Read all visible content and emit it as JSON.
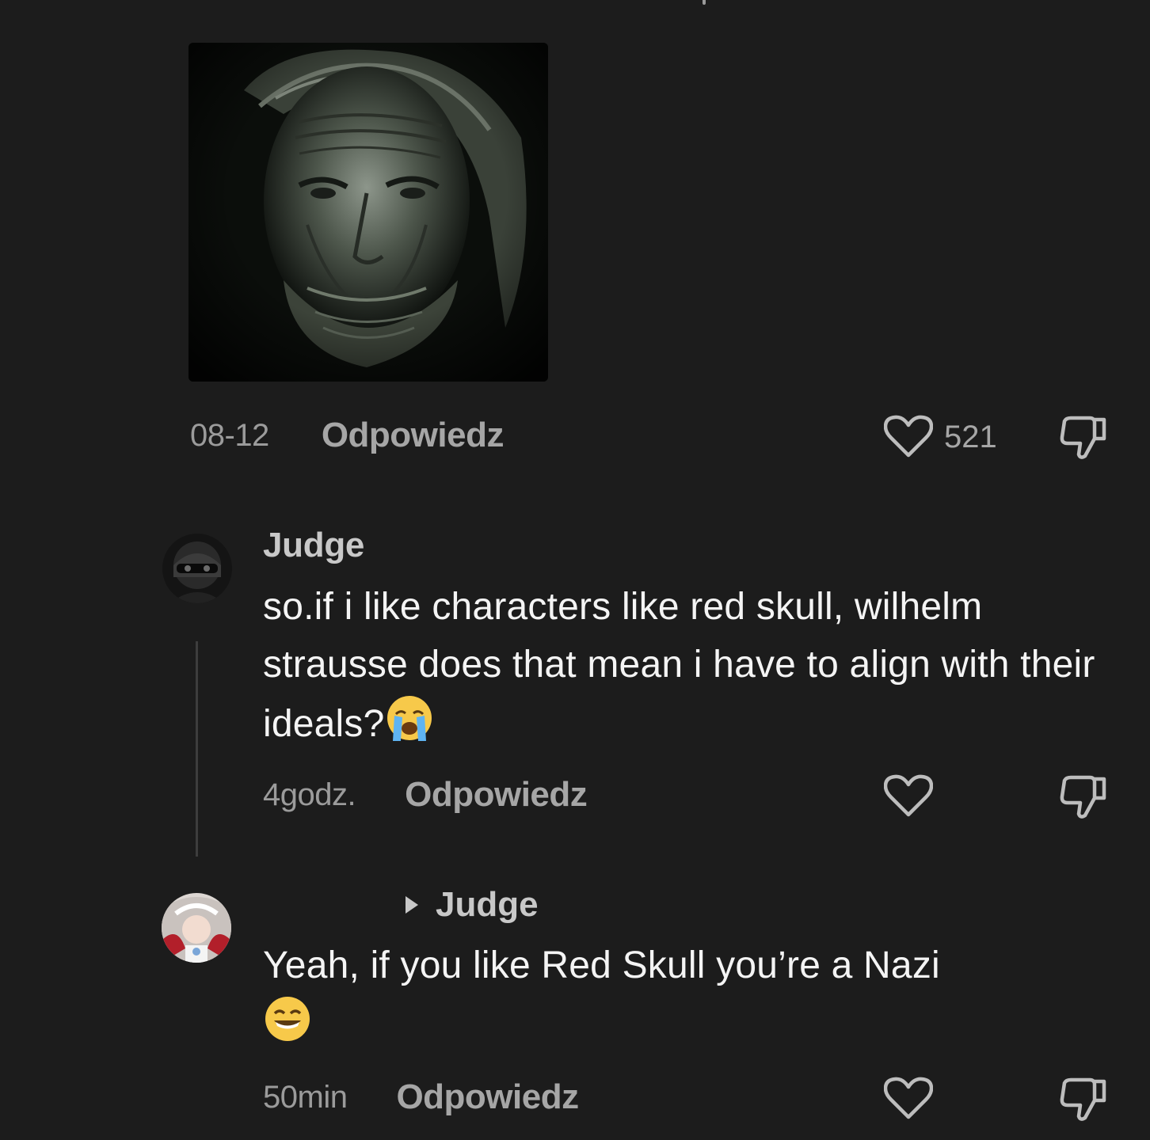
{
  "top_comment": {
    "time": "08-12",
    "reply_label": "Odpowiedz",
    "likes": "521"
  },
  "comment_judge": {
    "username": "Judge",
    "text": "so.if i like characters like red skull, wilhelm strausse does that mean i have to align with their ideals?",
    "emoji": "loudly-crying-face",
    "time": "4godz.",
    "reply_label": "Odpowiedz"
  },
  "reply_comment": {
    "reply_to": "Judge",
    "text": "Yeah, if you like Red Skull you’re a Nazi",
    "emoji": "grinning-face-with-smiling-eyes",
    "time": "50min",
    "reply_label": "Odpowiedz"
  },
  "colors": {
    "background": "#1c1c1c",
    "text_primary": "#f4f4f4",
    "text_secondary": "#9b9b9b",
    "icon": "#bdbdbd"
  }
}
